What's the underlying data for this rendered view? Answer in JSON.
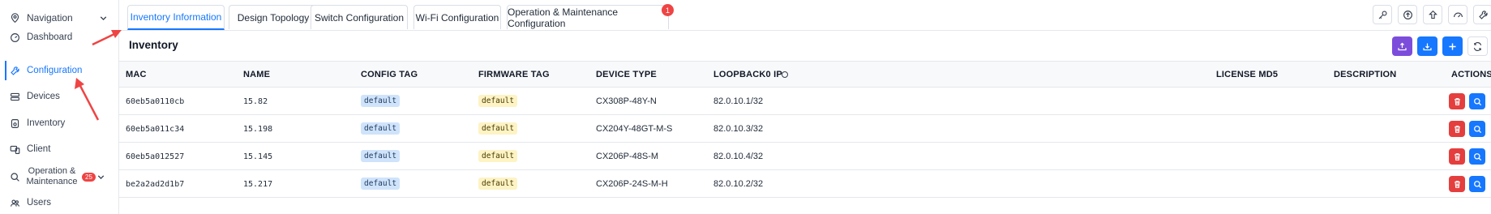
{
  "sidebar": {
    "nav_label": "Navigation",
    "items": [
      {
        "label": "Dashboard",
        "icon": "gauge-icon"
      },
      {
        "label": "Configuration",
        "icon": "wrench-icon",
        "active": true
      },
      {
        "label": "Devices",
        "icon": "server-icon"
      },
      {
        "label": "Inventory",
        "icon": "inventory-icon"
      },
      {
        "label": "Client",
        "icon": "devices-icon"
      },
      {
        "label": "Operation &",
        "label2": "Maintenance",
        "badge": "25",
        "icon": "search-icon"
      },
      {
        "label": "Users",
        "icon": "users-icon"
      }
    ]
  },
  "tabs": [
    {
      "label": "Inventory Information",
      "active": true
    },
    {
      "label": "Design Topology"
    },
    {
      "label": "Switch Configuration"
    },
    {
      "label": "Wi-Fi Configuration"
    },
    {
      "label": "Operation & Maintenance Configuration",
      "badge": "1"
    }
  ],
  "top_icons": [
    "key-icon",
    "upload-circle-icon",
    "upload-arrow-icon",
    "speedometer-icon",
    "wrench-icon"
  ],
  "section": {
    "title": "Inventory"
  },
  "actions": {
    "colors": {
      "upload": "#7c4ddb",
      "blue": "#1677ff"
    }
  },
  "table": {
    "headers": [
      "MAC",
      "NAME",
      "CONFIG TAG",
      "FIRMWARE TAG",
      "DEVICE TYPE",
      "LOOPBACK0 IP",
      "LICENSE MD5",
      "DESCRIPTION",
      "ACTIONS"
    ],
    "rows": [
      {
        "mac": "60eb5a0110cb",
        "name": "15.82",
        "config_tag": "default",
        "firmware_tag": "default",
        "device_type": "CX308P-48Y-N",
        "loopback": "82.0.10.1/32"
      },
      {
        "mac": "60eb5a011c34",
        "name": "15.198",
        "config_tag": "default",
        "firmware_tag": "default",
        "device_type": "CX204Y-48GT-M-S",
        "loopback": "82.0.10.3/32"
      },
      {
        "mac": "60eb5a012527",
        "name": "15.145",
        "config_tag": "default",
        "firmware_tag": "default",
        "device_type": "CX206P-48S-M",
        "loopback": "82.0.10.4/32"
      },
      {
        "mac": "be2a2ad2d1b7",
        "name": "15.217",
        "config_tag": "default",
        "firmware_tag": "default",
        "device_type": "CX206P-24S-M-H",
        "loopback": "82.0.10.2/32"
      }
    ]
  },
  "colors": {
    "accent": "#1677ff",
    "danger": "#e53e3e",
    "annotation": "#ef4444"
  }
}
